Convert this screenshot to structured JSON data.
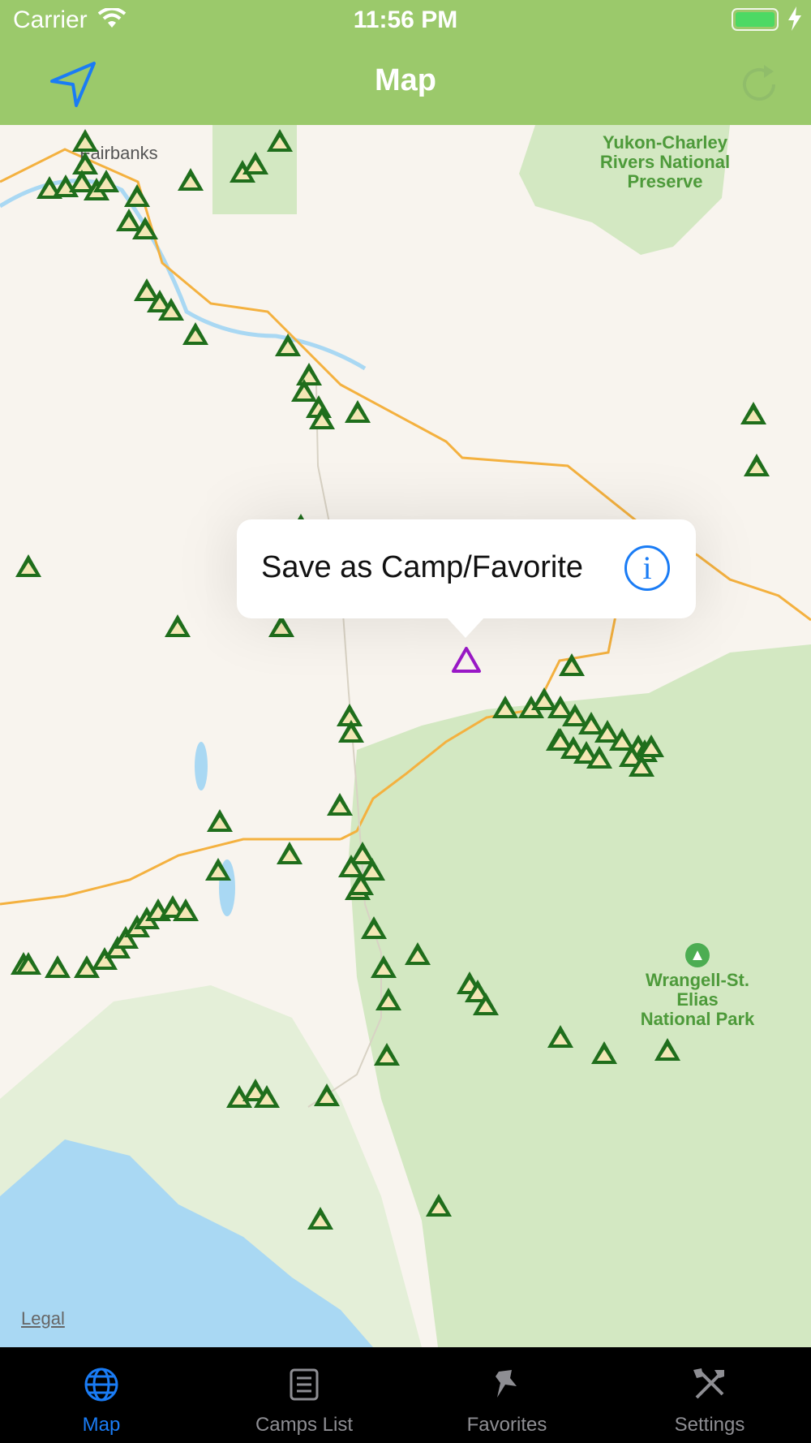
{
  "status_bar": {
    "carrier": "Carrier",
    "time": "11:56 PM"
  },
  "nav": {
    "title": "Map",
    "left_icon": "location-arrow-icon",
    "right_icon": "refresh-icon"
  },
  "map": {
    "labels": {
      "yukon": "Yukon-Charley\nRivers National\nPreserve",
      "fairbanks": "Fairbanks",
      "wrangell": "Wrangell-St.\nElias\nNational Park"
    },
    "legal": "Legal"
  },
  "callout": {
    "text": "Save as Camp/Favorite",
    "info_glyph": "i"
  },
  "tabs": [
    {
      "label": "Map",
      "icon": "globe-icon",
      "active": true
    },
    {
      "label": "Camps List",
      "icon": "list-icon",
      "active": false
    },
    {
      "label": "Favorites",
      "icon": "pin-icon",
      "active": false
    },
    {
      "label": "Settings",
      "icon": "tools-icon",
      "active": false
    }
  ],
  "colors": {
    "nav_bar": "#9bc96b",
    "accent_blue": "#1a7cf5",
    "camp_green": "#1f6e1c",
    "selected_camp": "#9a19c7",
    "park_green": "#d3e8c2",
    "water": "#a9d8f3",
    "road": "#f4b13f"
  }
}
